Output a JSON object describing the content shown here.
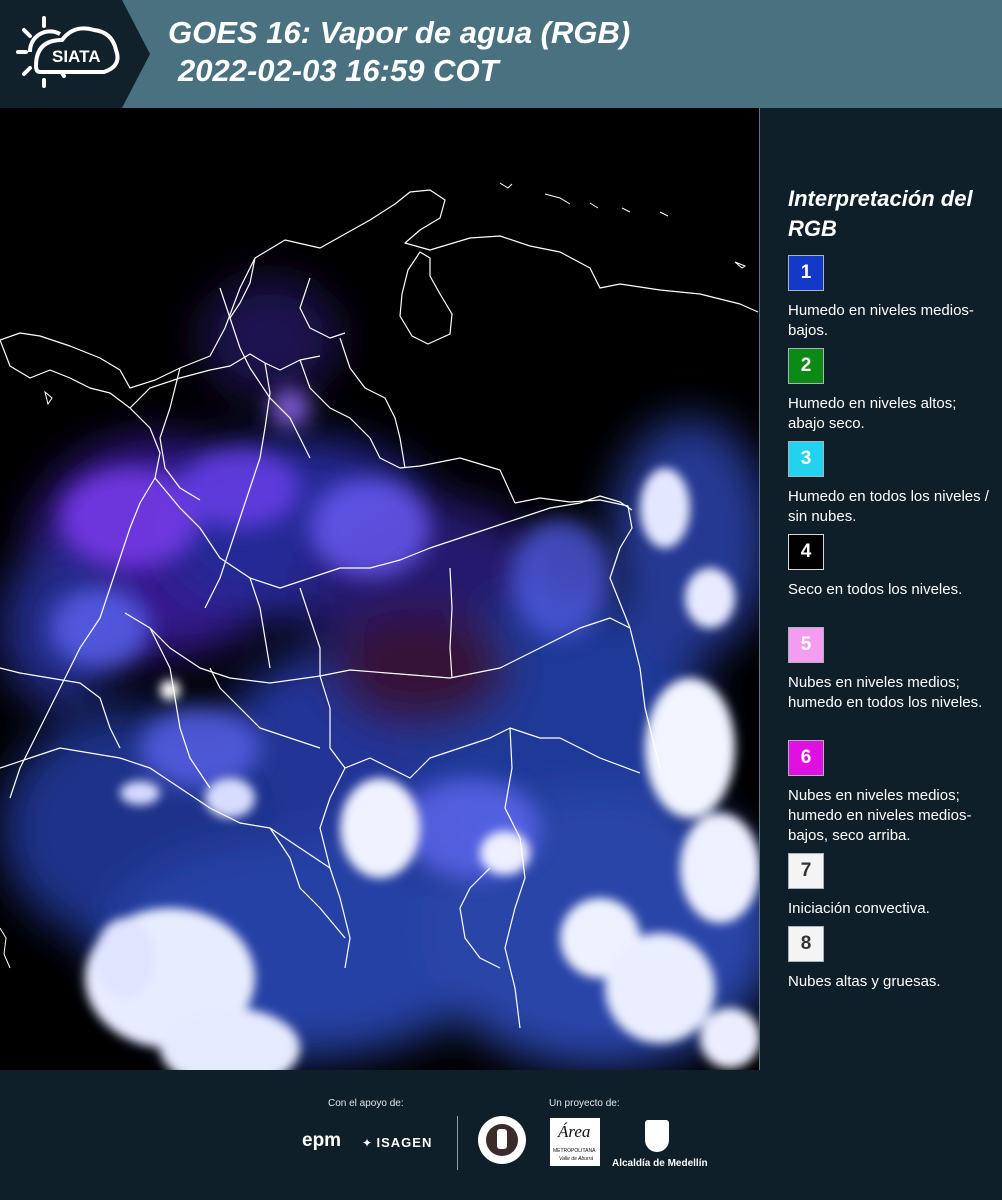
{
  "header": {
    "logo_text": "SIATA",
    "title_line1": "GOES 16: Vapor de agua (RGB)",
    "title_line2": "2022-02-03 16:59 COT"
  },
  "legend": {
    "title": "Interpretación del RGB",
    "items": [
      {
        "number": "1",
        "color": "#1438c8",
        "text_color": "#ffffff",
        "description": "Humedo en niveles medios-bajos."
      },
      {
        "number": "2",
        "color": "#0b8a15",
        "text_color": "#ffffff",
        "description": "Humedo en niveles altos; abajo seco."
      },
      {
        "number": "3",
        "color": "#22d2ee",
        "text_color": "#ffffff",
        "description": "Humedo en todos los niveles / sin nubes."
      },
      {
        "number": "4",
        "color": "#000000",
        "text_color": "#ffffff",
        "description": "Seco en todos los niveles."
      },
      {
        "number": "5",
        "color": "#f39cf0",
        "text_color": "#ffffff",
        "description": "Nubes en niveles medios; humedo en todos los niveles."
      },
      {
        "number": "6",
        "color": "#e010e0",
        "text_color": "#ffffff",
        "description": "Nubes en niveles medios; humedo en niveles medios-bajos, seco arriba."
      },
      {
        "number": "7",
        "color": "#f4f4f4",
        "text_color": "#333333",
        "description": "Iniciación convectiva."
      },
      {
        "number": "8",
        "color": "#f4f4f4",
        "text_color": "#333333",
        "description": "Nubes altas y gruesas."
      }
    ]
  },
  "footer": {
    "support_label": "Con el apoyo de:",
    "project_label": "Un proyecto de:",
    "epm": "epm",
    "isagen": "ISAGEN",
    "area_logo": "Área",
    "area_sub": "METROPOLITANA",
    "area_sub2": "Valle de Aburrá",
    "alcaldia": "Alcaldía de Medellín"
  }
}
